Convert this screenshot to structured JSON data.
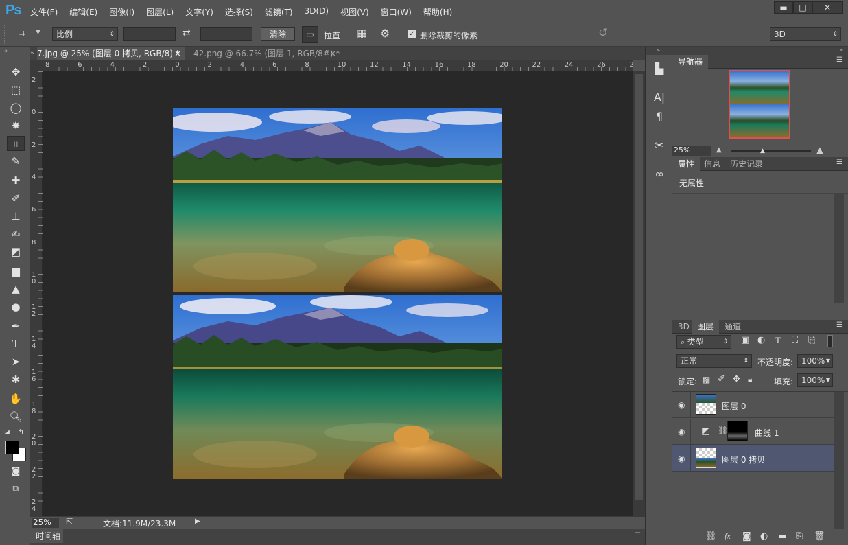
{
  "app": {
    "logo": "Ps"
  },
  "menus": [
    "文件(F)",
    "编辑(E)",
    "图像(I)",
    "图层(L)",
    "文字(Y)",
    "选择(S)",
    "滤镜(T)",
    "3D(D)",
    "视图(V)",
    "窗口(W)",
    "帮助(H)"
  ],
  "window_buttons": {
    "minimize": "▬",
    "maximize": "□",
    "close": "✕"
  },
  "options": {
    "ratio_select": "比例",
    "clear_button": "清除",
    "straighten_label": "拉直",
    "delete_cropped_label": "删除裁剪的像素",
    "workspace_select": "3D"
  },
  "tabs": [
    {
      "label": "7.jpg @ 25% (图层 0 拷贝, RGB/8) *",
      "close": "×"
    },
    {
      "label": "42.png @ 66.7% (图层 1, RGB/8#) *",
      "close": "×"
    }
  ],
  "ruler": {
    "h_labels": [
      "8",
      "6",
      "4",
      "2",
      "0",
      "2",
      "4",
      "6",
      "8",
      "10",
      "12",
      "14",
      "16",
      "18",
      "20",
      "22",
      "24",
      "26",
      "2"
    ],
    "v_labels": [
      "2",
      "0",
      "2",
      "4",
      "6",
      "8",
      "1\n0",
      "1\n2",
      "1\n4",
      "1\n6",
      "1\n8",
      "2\n0",
      "2\n2",
      "2\n4"
    ]
  },
  "status": {
    "zoom": "25%",
    "doc": "文档:11.9M/23.3M"
  },
  "timeline": {
    "label": "时间轴"
  },
  "navigator": {
    "title": "导航器",
    "zoom": "25%"
  },
  "properties": {
    "tabs": [
      "属性",
      "信息",
      "历史记录"
    ],
    "empty_text": "无属性"
  },
  "layers_panel": {
    "tabs": [
      "3D",
      "图层",
      "通道"
    ],
    "filter_select": "类型",
    "blend_mode": "正常",
    "opacity_label": "不透明度:",
    "opacity_value": "100%",
    "lock_label": "锁定:",
    "fill_label": "填充:",
    "fill_value": "100%",
    "layers": [
      {
        "name": "图层 0",
        "selected": false
      },
      {
        "name": "曲线 1",
        "selected": false
      },
      {
        "name": "图层 0 拷贝",
        "selected": true
      }
    ]
  },
  "colors": {
    "accent_selected": "#4f5870",
    "navigator_frame": "#e05050"
  }
}
